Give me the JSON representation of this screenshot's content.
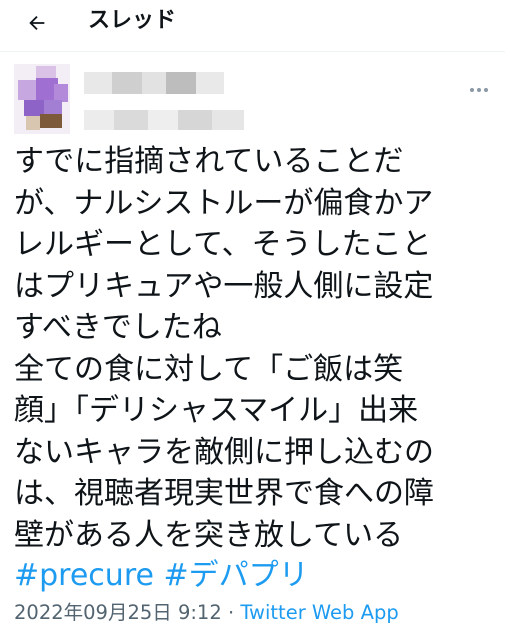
{
  "header": {
    "title": "スレッド",
    "back_icon": "arrow-left-icon"
  },
  "tweet": {
    "lines": [
      "すでに指摘されていることだ",
      "が、ナルシストルーが偏食かア",
      "レルギーとして、そうしたこと",
      "はプリキュアや一般人側に設定",
      "すべきでしたね",
      "全ての食に対して「ご飯は笑",
      "顔」「デリシャスマイル」出来",
      "ないキャラを敵側に押し込むの",
      "は、視聴者現実世界で食への障",
      "壁がある人を突き放している"
    ],
    "hashtags": [
      "#precure",
      "#デパプリ"
    ],
    "timestamp": "2022年09月25日 9:12",
    "separator": "·",
    "source": "Twitter Web App"
  },
  "colors": {
    "link": "#1d9bf0",
    "text": "#0f1419",
    "muted": "#536471"
  }
}
